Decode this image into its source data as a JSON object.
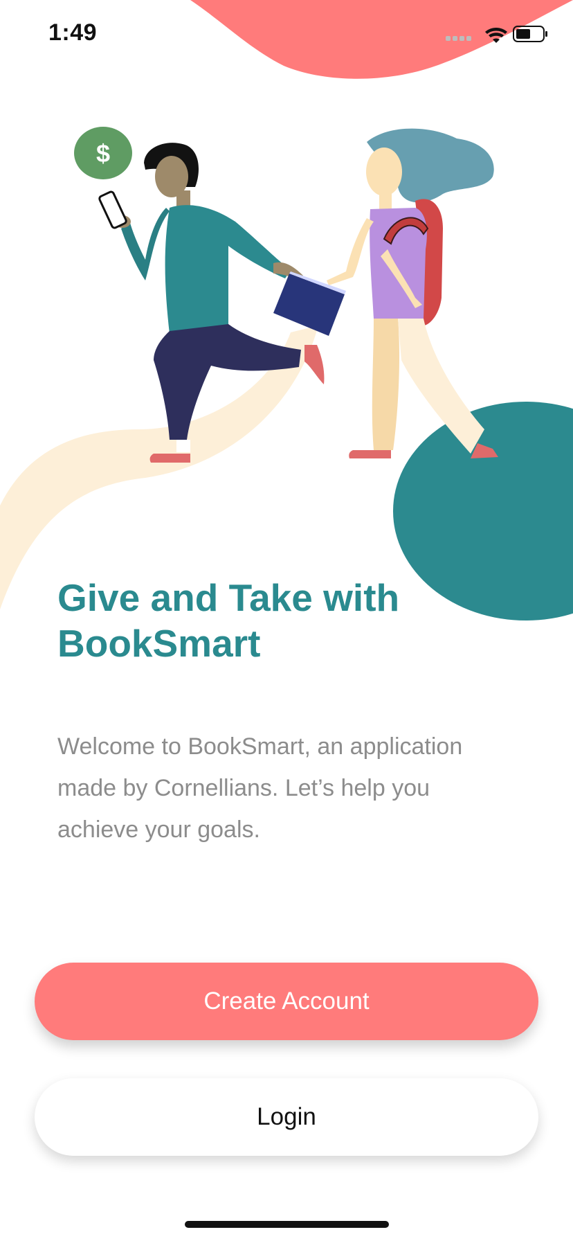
{
  "status_bar": {
    "time": "1:49"
  },
  "headline": {
    "text": "Give and Take with BookSmart"
  },
  "description": {
    "text": "Welcome to BookSmart, an application made by Cornellians. Let’s help you achieve your goals."
  },
  "buttons": {
    "create_account": "Create Account",
    "login": "Login"
  },
  "illustration": {
    "coin_symbol": "$"
  },
  "colors": {
    "accent_coral": "#ff7b7b",
    "accent_teal": "#2a8a8f",
    "body_gray": "#8c8c8c",
    "path_cream": "#fdefd8"
  }
}
